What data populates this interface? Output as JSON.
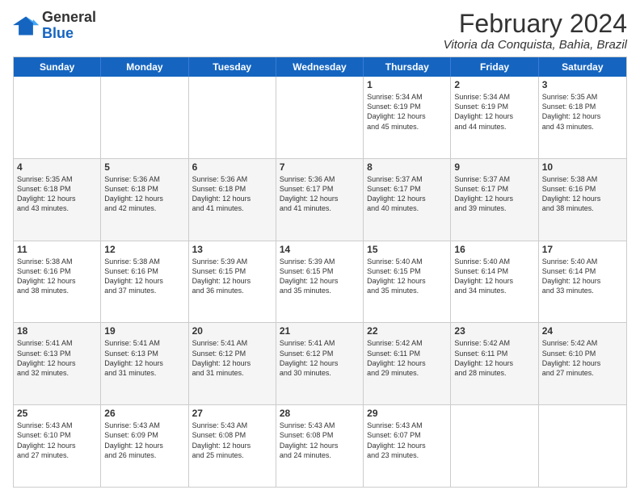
{
  "logo": {
    "general": "General",
    "blue": "Blue"
  },
  "header": {
    "month": "February 2024",
    "location": "Vitoria da Conquista, Bahia, Brazil"
  },
  "day_headers": [
    "Sunday",
    "Monday",
    "Tuesday",
    "Wednesday",
    "Thursday",
    "Friday",
    "Saturday"
  ],
  "weeks": [
    [
      {
        "date": "",
        "info": ""
      },
      {
        "date": "",
        "info": ""
      },
      {
        "date": "",
        "info": ""
      },
      {
        "date": "",
        "info": ""
      },
      {
        "date": "1",
        "info": "Sunrise: 5:34 AM\nSunset: 6:19 PM\nDaylight: 12 hours\nand 45 minutes."
      },
      {
        "date": "2",
        "info": "Sunrise: 5:34 AM\nSunset: 6:19 PM\nDaylight: 12 hours\nand 44 minutes."
      },
      {
        "date": "3",
        "info": "Sunrise: 5:35 AM\nSunset: 6:18 PM\nDaylight: 12 hours\nand 43 minutes."
      }
    ],
    [
      {
        "date": "4",
        "info": "Sunrise: 5:35 AM\nSunset: 6:18 PM\nDaylight: 12 hours\nand 43 minutes."
      },
      {
        "date": "5",
        "info": "Sunrise: 5:36 AM\nSunset: 6:18 PM\nDaylight: 12 hours\nand 42 minutes."
      },
      {
        "date": "6",
        "info": "Sunrise: 5:36 AM\nSunset: 6:18 PM\nDaylight: 12 hours\nand 41 minutes."
      },
      {
        "date": "7",
        "info": "Sunrise: 5:36 AM\nSunset: 6:17 PM\nDaylight: 12 hours\nand 41 minutes."
      },
      {
        "date": "8",
        "info": "Sunrise: 5:37 AM\nSunset: 6:17 PM\nDaylight: 12 hours\nand 40 minutes."
      },
      {
        "date": "9",
        "info": "Sunrise: 5:37 AM\nSunset: 6:17 PM\nDaylight: 12 hours\nand 39 minutes."
      },
      {
        "date": "10",
        "info": "Sunrise: 5:38 AM\nSunset: 6:16 PM\nDaylight: 12 hours\nand 38 minutes."
      }
    ],
    [
      {
        "date": "11",
        "info": "Sunrise: 5:38 AM\nSunset: 6:16 PM\nDaylight: 12 hours\nand 38 minutes."
      },
      {
        "date": "12",
        "info": "Sunrise: 5:38 AM\nSunset: 6:16 PM\nDaylight: 12 hours\nand 37 minutes."
      },
      {
        "date": "13",
        "info": "Sunrise: 5:39 AM\nSunset: 6:15 PM\nDaylight: 12 hours\nand 36 minutes."
      },
      {
        "date": "14",
        "info": "Sunrise: 5:39 AM\nSunset: 6:15 PM\nDaylight: 12 hours\nand 35 minutes."
      },
      {
        "date": "15",
        "info": "Sunrise: 5:40 AM\nSunset: 6:15 PM\nDaylight: 12 hours\nand 35 minutes."
      },
      {
        "date": "16",
        "info": "Sunrise: 5:40 AM\nSunset: 6:14 PM\nDaylight: 12 hours\nand 34 minutes."
      },
      {
        "date": "17",
        "info": "Sunrise: 5:40 AM\nSunset: 6:14 PM\nDaylight: 12 hours\nand 33 minutes."
      }
    ],
    [
      {
        "date": "18",
        "info": "Sunrise: 5:41 AM\nSunset: 6:13 PM\nDaylight: 12 hours\nand 32 minutes."
      },
      {
        "date": "19",
        "info": "Sunrise: 5:41 AM\nSunset: 6:13 PM\nDaylight: 12 hours\nand 31 minutes."
      },
      {
        "date": "20",
        "info": "Sunrise: 5:41 AM\nSunset: 6:12 PM\nDaylight: 12 hours\nand 31 minutes."
      },
      {
        "date": "21",
        "info": "Sunrise: 5:41 AM\nSunset: 6:12 PM\nDaylight: 12 hours\nand 30 minutes."
      },
      {
        "date": "22",
        "info": "Sunrise: 5:42 AM\nSunset: 6:11 PM\nDaylight: 12 hours\nand 29 minutes."
      },
      {
        "date": "23",
        "info": "Sunrise: 5:42 AM\nSunset: 6:11 PM\nDaylight: 12 hours\nand 28 minutes."
      },
      {
        "date": "24",
        "info": "Sunrise: 5:42 AM\nSunset: 6:10 PM\nDaylight: 12 hours\nand 27 minutes."
      }
    ],
    [
      {
        "date": "25",
        "info": "Sunrise: 5:43 AM\nSunset: 6:10 PM\nDaylight: 12 hours\nand 27 minutes."
      },
      {
        "date": "26",
        "info": "Sunrise: 5:43 AM\nSunset: 6:09 PM\nDaylight: 12 hours\nand 26 minutes."
      },
      {
        "date": "27",
        "info": "Sunrise: 5:43 AM\nSunset: 6:08 PM\nDaylight: 12 hours\nand 25 minutes."
      },
      {
        "date": "28",
        "info": "Sunrise: 5:43 AM\nSunset: 6:08 PM\nDaylight: 12 hours\nand 24 minutes."
      },
      {
        "date": "29",
        "info": "Sunrise: 5:43 AM\nSunset: 6:07 PM\nDaylight: 12 hours\nand 23 minutes."
      },
      {
        "date": "",
        "info": ""
      },
      {
        "date": "",
        "info": ""
      }
    ]
  ]
}
